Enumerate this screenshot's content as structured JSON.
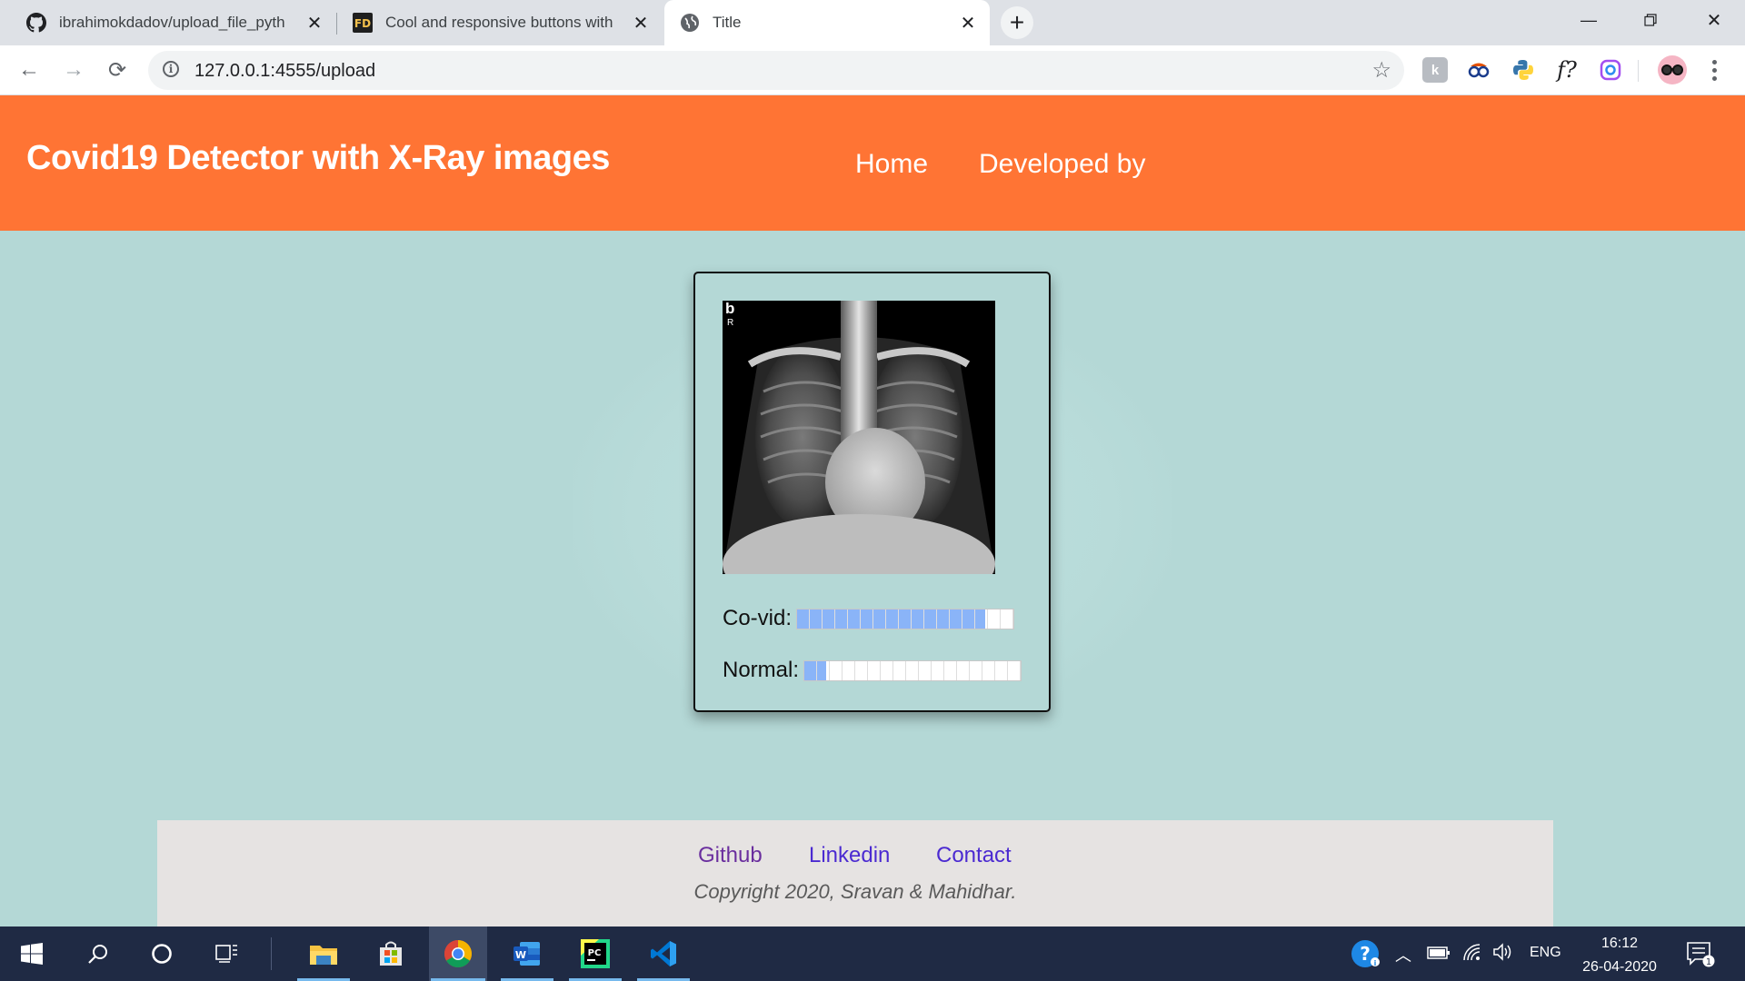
{
  "browser": {
    "tabs": [
      {
        "title": "ibrahimokdadov/upload_file_pyth",
        "icon": "github-icon"
      },
      {
        "title": "Cool and responsive buttons with",
        "icon": "fd-favicon-icon"
      },
      {
        "title": "Title",
        "icon": "globe-icon"
      }
    ],
    "url": "127.0.0.1:4555/upload",
    "extensions": [
      "extension-icon",
      "spy-glasses-icon",
      "python-icon",
      "formula-icon",
      "instagram-icon"
    ]
  },
  "site": {
    "title": "Covid19 Detector with X-Ray images",
    "nav": [
      "Home",
      "Developed by"
    ],
    "header_color": "#ff7434",
    "background_color": "#b4d8d6"
  },
  "result": {
    "image_label_main": "b",
    "image_label_side": "R",
    "items": [
      {
        "label": "Co-vid:",
        "value": 0.87
      },
      {
        "label": "Normal:",
        "value": 0.1
      }
    ]
  },
  "footer": {
    "links": [
      "Github",
      "Linkedin",
      "Contact"
    ],
    "copyright": "Copyright 2020, Sravan & Mahidhar."
  },
  "taskbar": {
    "time": "16:12",
    "date": "26-04-2020",
    "language": "ENG",
    "notification_count": "1"
  }
}
